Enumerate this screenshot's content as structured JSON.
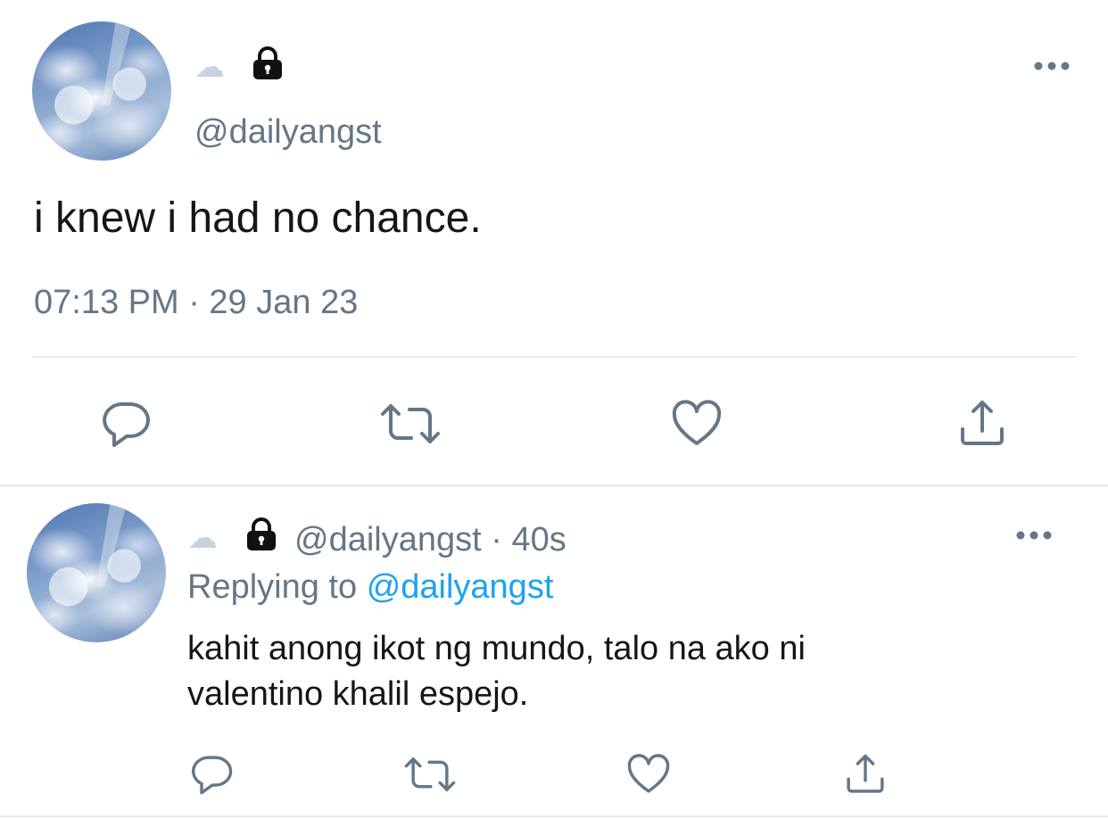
{
  "main_tweet": {
    "display_name_emoji": "☁",
    "handle": "@dailyangst",
    "text": "i knew i had no chance.",
    "timestamp": "07:13 PM · 29 Jan 23",
    "more_icon": "more-dots-icon"
  },
  "reply_tweet": {
    "display_name_emoji": "☁",
    "handle_time": "@dailyangst · 40s",
    "replying_prefix": "Replying to",
    "replying_to": "@dailyangst",
    "text_line1": "kahit anong ikot ng mundo, talo na ako ni",
    "text_line2": "valentino khalil espejo."
  },
  "actions": [
    "reply-icon",
    "retweet-icon",
    "like-icon",
    "share-icon"
  ],
  "colors": {
    "text": "#14171a",
    "muted": "#657786",
    "link": "#1da1f2",
    "divider": "#e6ecf0"
  }
}
